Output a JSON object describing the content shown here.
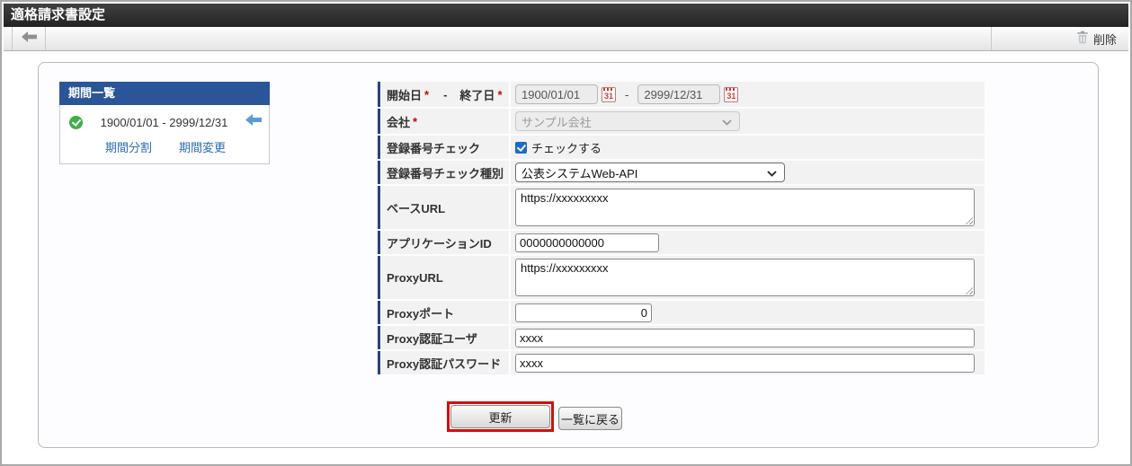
{
  "header": {
    "title": "適格請求書設定"
  },
  "toolbar": {
    "delete_label": "削除"
  },
  "period_panel": {
    "title": "期間一覧",
    "period": {
      "start": "1900/01/01",
      "separator": "-",
      "end": "2999/12/31"
    },
    "split_link": "期間分割",
    "change_link": "期間変更"
  },
  "icons": {
    "calendar_day": "31"
  },
  "form": {
    "required_mark": "*",
    "date_label_separator": "-",
    "start_date": {
      "label": "開始日",
      "value": "1900/01/01"
    },
    "end_date": {
      "label": "終了日",
      "value": "2999/12/31"
    },
    "date_range_separator": "-",
    "company": {
      "label": "会社",
      "value": "サンプル会社"
    },
    "reg_check": {
      "label": "登録番号チェック",
      "checkbox_label": "チェックする",
      "checked": true
    },
    "reg_check_type": {
      "label": "登録番号チェック種別",
      "value": "公表システムWeb-API"
    },
    "base_url": {
      "label": "ベースURL",
      "value": "https://xxxxxxxxx"
    },
    "app_id": {
      "label": "アプリケーションID",
      "value": "0000000000000"
    },
    "proxy_url": {
      "label": "ProxyURL",
      "value": "https://xxxxxxxxx"
    },
    "proxy_port": {
      "label": "Proxyポート",
      "value": "0"
    },
    "proxy_user": {
      "label": "Proxy認証ユーザ",
      "value": "xxxx"
    },
    "proxy_password": {
      "label": "Proxy認証パスワード",
      "value": "xxxx"
    }
  },
  "actions": {
    "update": "更新",
    "back_to_list": "一覧に戻る"
  }
}
